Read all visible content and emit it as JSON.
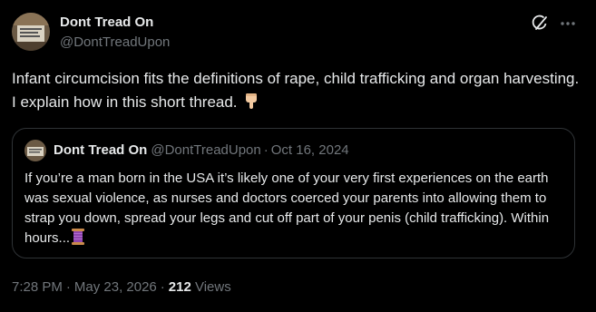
{
  "post": {
    "author_name": "Dont Tread On",
    "author_handle": "@DontTreadUpon",
    "text": "Infant circumcision fits the definitions of rape, child trafficking and organ harvesting. I explain how in this short thread.",
    "emoji_icon": "pointing-down-hand-icon",
    "time": "7:28 PM",
    "date": "May 23, 2026",
    "separator": "·",
    "views_count": "212",
    "views_label": "Views"
  },
  "quote": {
    "author_name": "Dont Tread On",
    "author_handle": "@DontTreadUpon",
    "separator": "·",
    "date": "Oct 16, 2024",
    "text": "If you’re a man born in the USA it’s likely one of your very first experiences on the earth was sexual violence, as nurses and doctors coerced your parents into allowing them to strap you down, spread your legs and cut off part of your penis (child trafficking). Within hours...",
    "emoji_icon": "thread-spool-icon"
  },
  "colors": {
    "background": "#000000",
    "text_primary": "#e7e9ea",
    "text_secondary": "#71767b",
    "border": "#2f3336"
  },
  "icons": {
    "grok": "grok-icon",
    "more": "more-icon"
  }
}
